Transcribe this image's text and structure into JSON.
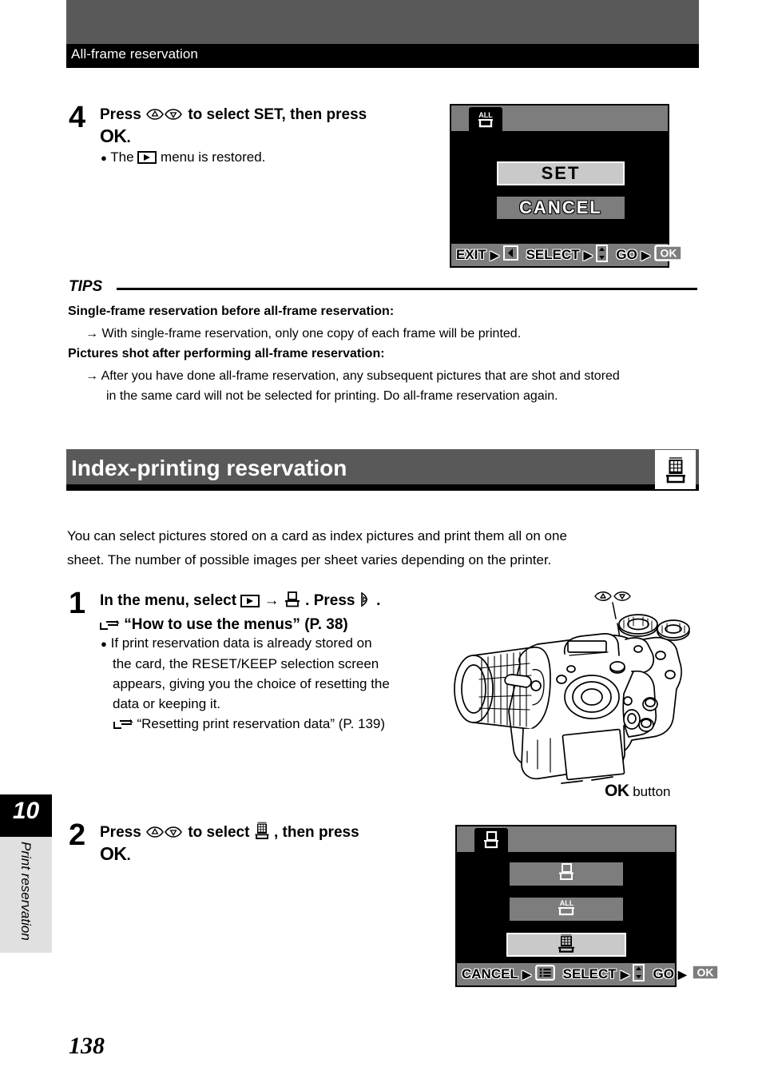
{
  "header": {
    "title": "All-frame reservation"
  },
  "step4": {
    "number": "4",
    "line1_a": "Press",
    "line1_b": "to select SET, then press",
    "ok": "OK",
    "period": ".",
    "bullet": "●",
    "sub_a": "The",
    "sub_b": "menu is restored.",
    "icon_updown": "updown-arrow-icon",
    "icon_playback": "playback-icon"
  },
  "lcd1": {
    "name": "all-frame-reservation-screen",
    "tab_icon": "all-print-icon",
    "rows": [
      {
        "label": "SET",
        "selected": true
      },
      {
        "label": "CANCEL",
        "selected": false
      }
    ],
    "footer": [
      {
        "text": "EXIT",
        "arrow": "▶",
        "icon": "left-arrow-key-icon"
      },
      {
        "text": "SELECT",
        "arrow": "▶",
        "icon": "updown-key-icon"
      },
      {
        "text": "GO",
        "arrow": "▶",
        "icon": "ok-key-icon"
      }
    ]
  },
  "tips": {
    "label": "TIPS",
    "heading1": "Single-frame reservation before all-frame reservation:",
    "body1": "With single-frame reservation, only one copy of each frame will be printed.",
    "heading2": "Pictures shot after performing all-frame reservation:",
    "body2_line1": "After you have done all-frame reservation, any subsequent pictures that are shot and stored",
    "body2_line2": "in the same card will not be selected for printing. Do all-frame reservation again.",
    "arrow": "→"
  },
  "section": {
    "title": "Index-printing reservation",
    "icon": "index-print-icon"
  },
  "intro": {
    "line1": "You can select pictures stored on a card as index pictures and print them all on one",
    "line2": "sheet. The number of possible images per sheet varies depending on the printer."
  },
  "step1": {
    "number": "1",
    "line1_a": "In the menu, select",
    "arrow": "→",
    "line1_b": ". Press",
    "line1_c": ".",
    "ref_icon": "pointing-hand-icon",
    "ref": "“How to use the menus” (P. 38)",
    "bullet": "●",
    "body": [
      "If print reservation data is already stored on",
      "the card, the RESET/KEEP selection screen",
      "appears, giving you the choice of resetting the",
      "data or keeping it."
    ],
    "ref2": "“Resetting print reservation data” (P. 139)",
    "icon_playback": "playback-icon",
    "icon_print": "print-icon",
    "icon_right": "right-arrow-icon"
  },
  "camera": {
    "name": "camera-illustration",
    "ok_label_bold": "OK",
    "ok_label_rest": " button",
    "jog_icon": "updown-arrow-icon"
  },
  "step2": {
    "number": "2",
    "line1_a": "Press",
    "line1_b": "to select",
    "line1_c": ", then press",
    "ok": "OK",
    "period": ".",
    "icon_updown": "updown-arrow-icon",
    "icon_index": "index-print-icon"
  },
  "lcd2": {
    "name": "print-mode-menu-screen",
    "tab_icon": "print-icon",
    "rows": [
      {
        "icon": "print-icon",
        "selected": false
      },
      {
        "icon": "all-print-icon",
        "selected": false
      },
      {
        "icon": "index-print-icon",
        "selected": true
      }
    ],
    "footer": [
      {
        "text": "CANCEL",
        "arrow": "▶",
        "icon": "menu-key-icon"
      },
      {
        "text": "SELECT",
        "arrow": "▶",
        "icon": "updown-key-icon"
      },
      {
        "text": "GO",
        "arrow": "▶",
        "icon": "ok-key-icon"
      }
    ]
  },
  "sidetab": {
    "number": "10",
    "label": "Print reservation"
  },
  "page_number": "138",
  "colors": {
    "header_gray": "#595959",
    "lcd_gray": "#7d7d7d",
    "selected_gray": "#c9c9c9",
    "tab_gray": "#e0e0e0"
  }
}
